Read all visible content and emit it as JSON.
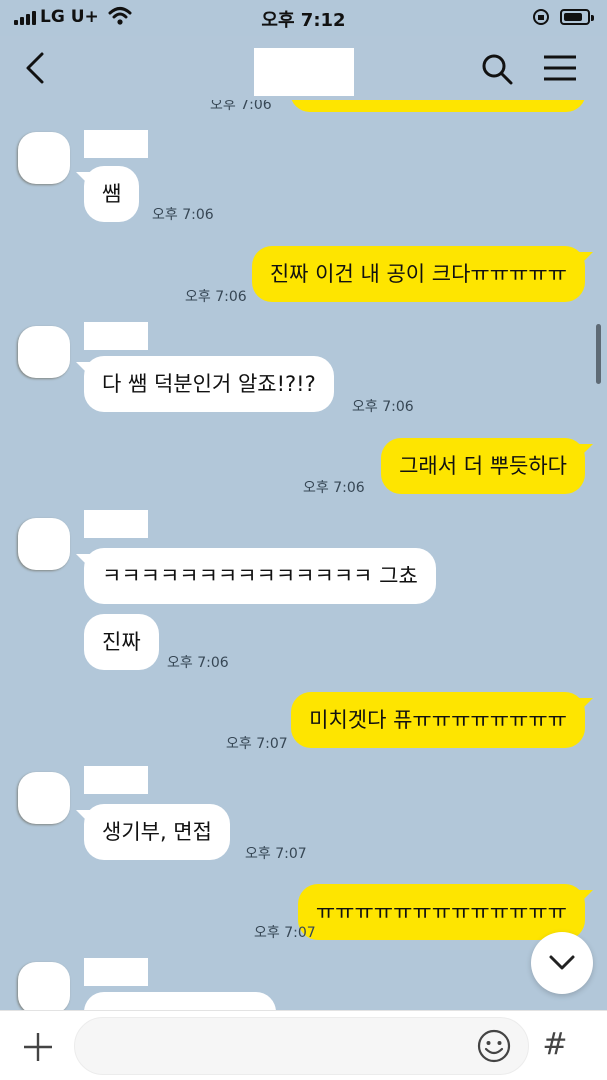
{
  "status_bar": {
    "carrier": "LG U+",
    "time": "오후 7:12"
  },
  "header": {
    "back_icon": "back-chevron-icon",
    "search_icon": "search-icon",
    "menu_icon": "hamburger-menu-icon"
  },
  "messages": [
    {
      "side": "out",
      "partial": true,
      "time": "오후 7:06"
    },
    {
      "side": "in",
      "text": "쌤",
      "time": "오후 7:06"
    },
    {
      "side": "out",
      "text": "진짜 이건 내 공이 크다ㅠㅠㅠㅠㅠ",
      "time": "오후 7:06"
    },
    {
      "side": "in",
      "text": "다 쌤 덕분인거 알죠!?!?",
      "time": "오후 7:06"
    },
    {
      "side": "out",
      "text": "그래서 더 뿌듯하다",
      "time": "오후 7:06"
    },
    {
      "side": "in",
      "text": "ㅋㅋㅋㅋㅋㅋㅋㅋㅋㅋㅋㅋㅋㅋ 그쵸"
    },
    {
      "side": "in",
      "text": "진짜",
      "time": "오후 7:06"
    },
    {
      "side": "out",
      "text": "미치겟다 퓨ㅠㅠㅠㅠㅠㅠㅠㅠ",
      "time": "오후 7:07"
    },
    {
      "side": "in",
      "text": "생기부, 면접",
      "time": "오후 7:07"
    },
    {
      "side": "out",
      "text": "ㅠㅠㅠㅠㅠㅠㅠㅠㅠㅠㅠㅠㅠ",
      "time": "오후 7:07"
    }
  ],
  "input_bar": {
    "placeholder": "",
    "plus_icon": "plus-icon",
    "emoji_icon": "emoji-icon",
    "hash_icon": "#"
  },
  "colors": {
    "background": "#b2c7d9",
    "my_bubble": "#fee500",
    "their_bubble": "#ffffff"
  }
}
